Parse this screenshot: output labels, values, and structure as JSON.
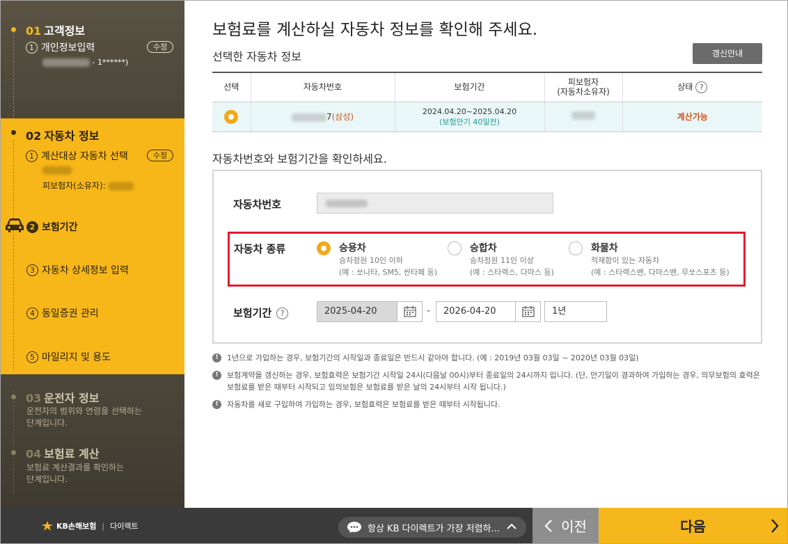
{
  "sidebar": {
    "step1": {
      "num": "01",
      "title": "고객정보",
      "sub_num": "1",
      "sub_label": "개인정보입력",
      "edit": "수정",
      "masked": "- 1******)"
    },
    "step2": {
      "num": "02",
      "title": "자동차 정보",
      "sub1_num": "1",
      "sub1_label": "계산대상 자동차 선택",
      "edit": "수정",
      "insured_label": "피보험자(소유자):",
      "sub2_num": "2",
      "sub2_label": "보험기간",
      "sub3_num": "3",
      "sub3_label": "자동차 상세정보 입력",
      "sub4_num": "4",
      "sub4_label": "동일증권 관리",
      "sub5_num": "5",
      "sub5_label": "마일리지 및 용도"
    },
    "step3": {
      "num": "03",
      "title": "운전자 정보",
      "desc1": "운전자의 범위와 연령을 선택하는",
      "desc2": "단계입니다."
    },
    "step4": {
      "num": "04",
      "title": "보험료 계산",
      "desc1": "보험료 계산결과를 확인하는",
      "desc2": "단계입니다."
    }
  },
  "main": {
    "title": "보험료를 계산하실 자동차 정보를 확인해 주세요.",
    "selected_title": "선택한 자동차 정보",
    "renew_button": "갱신안내",
    "table": {
      "headers": {
        "select": "선택",
        "car_no": "자동차번호",
        "period": "보험기간",
        "insured_1": "피보험자",
        "insured_2": "(자동차소유자)",
        "status": "상태"
      },
      "row": {
        "car_suffix": "7",
        "brand": "(삼성)",
        "period_dates": "2024.04.20~2025.04.20",
        "period_note": "(보험만기 40일전)",
        "status": "계산가능"
      }
    },
    "confirm_title": "자동차번호와 보험기간을 확인하세요.",
    "car_no_label": "자동차번호",
    "car_type_label": "자동차 종류",
    "options": [
      {
        "title": "승용차",
        "line1": "승차정원 10인 이하",
        "line2": "(예 : 쏘나타, SM5, 싼타페 등)"
      },
      {
        "title": "승합차",
        "line1": "승차정원 11인 이상",
        "line2": "(예 : 스타렉스, 다마스 등)"
      },
      {
        "title": "화물차",
        "line1": "적재함이 있는 자동차",
        "line2": "(예 : 스타렉스밴, 다마스밴, 무쏘스포츠 등)"
      }
    ],
    "period_label": "보험기간",
    "start_date": "2025-04-20",
    "dash": "-",
    "end_date": "2026-04-20",
    "duration": "1년",
    "notes": [
      "1년으로 가입하는 경우, 보험기간의 시작일과 종료일은 반드시 같아야 합니다. (예 : 2019년 03월 03일 ~ 2020년 03월 03일)",
      "보험계약을 갱신하는 경우, 보험효력은 보험기간 시작일 24시(다음날 00시)부터 종료일의 24시까지 입니다. (단, 만기일이 경과하여 가입하는 경우, 의무보험의 효력은 보험료를 받은 때부터 시작되고 임의보험은 보험료를 받은 날의 24시부터 시작 됩니다.)",
      "자동차를 새로 구입하여 가입하는 경우, 보험효력은 보험료를 받은 때부터 시작됩니다."
    ]
  },
  "footer": {
    "brand": "KB손해보험",
    "sep": "|",
    "brand_sub": "다이렉트",
    "chat_text": "항상 KB 다이렉트가 가장 저렴하...",
    "prev": "이전",
    "next": "다음"
  },
  "colors": {
    "accent": "#f5b71b",
    "highlight": "#e21a2e",
    "status": "#d0531c"
  }
}
